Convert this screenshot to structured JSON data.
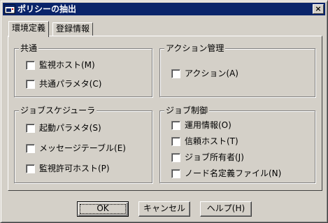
{
  "window": {
    "title": "ポリシーの抽出",
    "close_label": "×"
  },
  "tabs": [
    {
      "label": "環境定義",
      "active": true
    },
    {
      "label": "登録情報",
      "active": false
    }
  ],
  "groups": {
    "common": {
      "title": "共通",
      "items": [
        "監視ホスト(M)",
        "共通パラメタ(C)"
      ]
    },
    "action": {
      "title": "アクション管理",
      "items": [
        "アクション(A)"
      ]
    },
    "scheduler": {
      "title": "ジョブスケジューラ",
      "items": [
        "起動パラメタ(S)",
        "メッセージテーブル(E)",
        "監視許可ホスト(P)"
      ]
    },
    "jobcontrol": {
      "title": "ジョブ制御",
      "items": [
        "運用情報(O)",
        "信頼ホスト(T)",
        "ジョブ所有者(J)",
        "ノード名定義ファイル(N)"
      ]
    }
  },
  "buttons": {
    "ok": "OK",
    "cancel": "キャンセル",
    "help": "ヘルプ(H)"
  },
  "colors": {
    "titlebar": "#0a246a",
    "face": "#d4d0c8"
  }
}
